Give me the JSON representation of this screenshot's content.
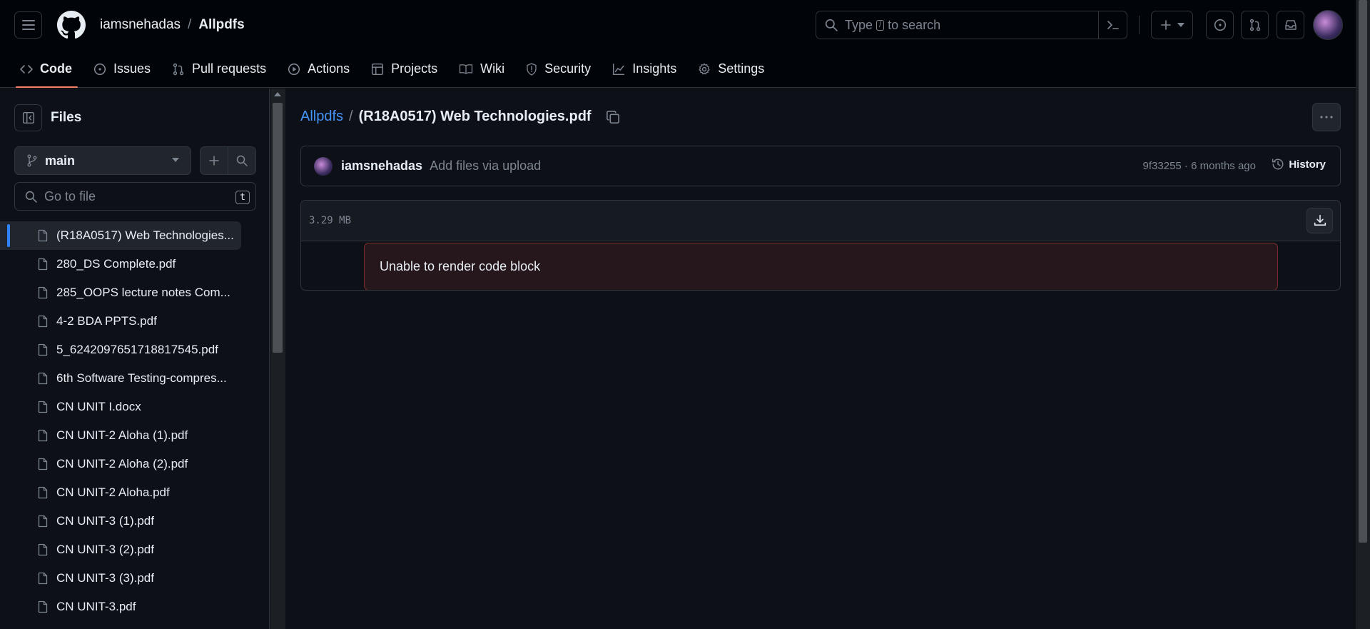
{
  "header": {
    "owner": "iamsnehadas",
    "separator": "/",
    "repo": "Allpdfs",
    "search_prefix": "Type",
    "search_key": "/",
    "search_suffix": "to search"
  },
  "nav": {
    "items": [
      {
        "label": "Code",
        "icon": "code-icon"
      },
      {
        "label": "Issues",
        "icon": "issue-icon"
      },
      {
        "label": "Pull requests",
        "icon": "pull-request-icon"
      },
      {
        "label": "Actions",
        "icon": "play-icon"
      },
      {
        "label": "Projects",
        "icon": "table-icon"
      },
      {
        "label": "Wiki",
        "icon": "book-icon"
      },
      {
        "label": "Security",
        "icon": "shield-icon"
      },
      {
        "label": "Insights",
        "icon": "graph-icon"
      },
      {
        "label": "Settings",
        "icon": "gear-icon"
      }
    ]
  },
  "sidebar": {
    "title": "Files",
    "branch": "main",
    "goto_placeholder": "Go to file",
    "goto_key": "t",
    "files": [
      "(R18A0517) Web Technologies...",
      "280_DS Complete.pdf",
      "285_OOPS lecture notes Com...",
      "4-2 BDA PPTS.pdf",
      "5_6242097651718817545.pdf",
      "6th Software Testing-compres...",
      "CN UNIT I.docx",
      "CN UNIT-2 Aloha (1).pdf",
      "CN UNIT-2 Aloha (2).pdf",
      "CN UNIT-2 Aloha.pdf",
      "CN UNIT-3 (1).pdf",
      "CN UNIT-3 (2).pdf",
      "CN UNIT-3 (3).pdf",
      "CN UNIT-3.pdf"
    ]
  },
  "main": {
    "repo_link": "Allpdfs",
    "separator": "/",
    "file_title": "(R18A0517) Web Technologies.pdf",
    "commit": {
      "author": "iamsnehadas",
      "message": "Add files via upload",
      "meta": "9f33255 · 6 months ago",
      "history_label": "History"
    },
    "blob": {
      "size": "3.29 MB",
      "error": "Unable to render code block"
    }
  },
  "colors": {
    "accent": "#f78166",
    "link": "#4493f8",
    "background": "#0d1117"
  }
}
